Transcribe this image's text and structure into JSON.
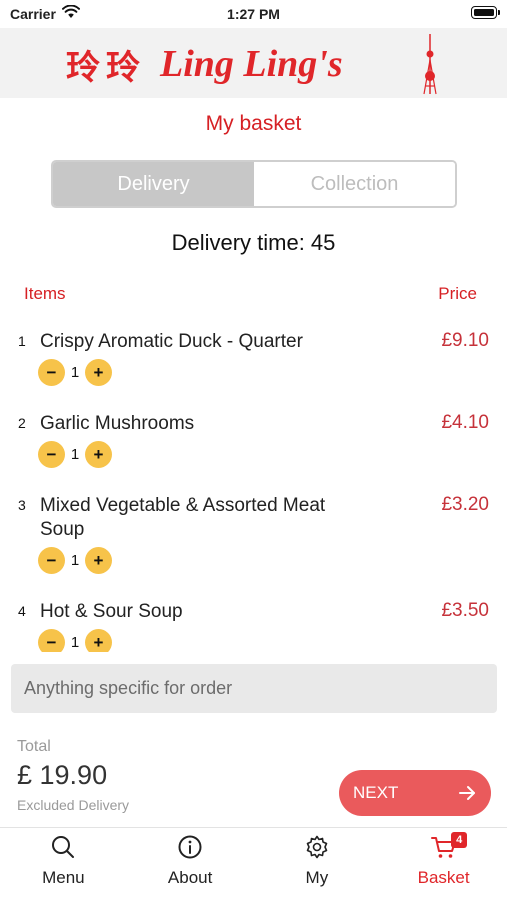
{
  "status_bar": {
    "carrier": "Carrier",
    "time": "1:27 PM"
  },
  "logo": {
    "chinese": "玲玲",
    "name": "Ling Ling's"
  },
  "page_title": "My basket",
  "order_type": {
    "options": [
      "Delivery",
      "Collection"
    ],
    "selected": "Delivery"
  },
  "delivery_time": "Delivery time: 45",
  "columns": {
    "items": "Items",
    "price": "Price"
  },
  "items": [
    {
      "index": "1",
      "name": "Crispy Aromatic Duck - Quarter",
      "price": "£9.10",
      "qty": "1"
    },
    {
      "index": "2",
      "name": "Garlic Mushrooms",
      "price": "£4.10",
      "qty": "1"
    },
    {
      "index": "3",
      "name": "Mixed Vegetable & Assorted Meat Soup",
      "price": "£3.20",
      "qty": "1"
    },
    {
      "index": "4",
      "name": "Hot & Sour Soup",
      "price": "£3.50",
      "qty": "1"
    }
  ],
  "qty_controls": {
    "minus": "−",
    "plus": "+"
  },
  "notes": {
    "placeholder": "Anything specific for order"
  },
  "total": {
    "label": "Total",
    "amount": "£ 19.90",
    "note": "Excluded Delivery"
  },
  "next_button": {
    "label": "NEXT"
  },
  "tabbar": {
    "tabs": [
      {
        "label": "Menu",
        "icon": "search-icon"
      },
      {
        "label": "About",
        "icon": "info-icon"
      },
      {
        "label": "My",
        "icon": "gear-icon"
      },
      {
        "label": "Basket",
        "icon": "cart-icon",
        "badge": "4",
        "active": true
      }
    ]
  },
  "colors": {
    "brand_red": "#e0262a",
    "qty_yellow": "#f7c34a",
    "next_red": "#ea5a5c"
  }
}
